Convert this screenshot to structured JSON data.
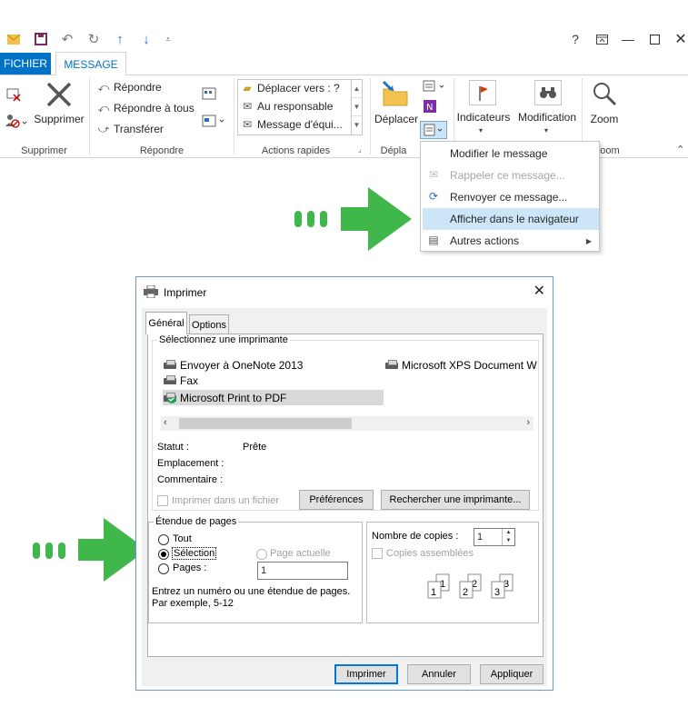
{
  "ribbon": {
    "tabs": {
      "fichier": "FICHIER",
      "message": "MESSAGE"
    },
    "supprimer": {
      "delete": "Supprimer",
      "group": "Supprimer"
    },
    "repondre": {
      "reply": "Répondre",
      "reply_all": "Répondre à tous",
      "forward": "Transférer",
      "group": "Répondre"
    },
    "quick_steps": {
      "items": [
        "Déplacer vers : ?",
        "Au responsable",
        "Message d'équi..."
      ],
      "group": "Actions rapides"
    },
    "deplacer": {
      "move": "Déplacer",
      "group": "Dépla"
    },
    "indicateurs": "Indicateurs",
    "modification": "Modification",
    "zoom": {
      "label": "Zoom",
      "group": "oom"
    },
    "title_buttons": {
      "help": "?"
    }
  },
  "menu": {
    "items": [
      {
        "label": "Modifier le message",
        "disabled": false
      },
      {
        "label": "Rappeler ce message...",
        "disabled": true
      },
      {
        "label": "Renvoyer ce message...",
        "disabled": false
      },
      {
        "label": "Afficher dans le navigateur",
        "disabled": false,
        "highlighted": true
      },
      {
        "label": "Autres actions",
        "disabled": false,
        "submenu": true
      }
    ]
  },
  "dialog": {
    "title": "Imprimer",
    "tabs": {
      "general": "Général",
      "options": "Options"
    },
    "printers_legend": "Sélectionnez une imprimante",
    "printers": {
      "onenote": "Envoyer à OneNote 2013",
      "fax": "Fax",
      "pdf": "Microsoft Print to PDF",
      "xps": "Microsoft XPS Document W"
    },
    "status_label": "Statut :",
    "status_value": "Prête",
    "location_label": "Emplacement :",
    "comment_label": "Commentaire :",
    "print_to_file": "Imprimer dans un fichier",
    "preferences": "Préférences",
    "find_printer": "Rechercher une imprimante...",
    "range_legend": "Étendue de pages",
    "range_all": "Tout",
    "range_selection": "Sélection",
    "range_current": "Page actuelle",
    "range_pages": "Pages :",
    "pages_value": "1",
    "range_hint_1": "Entrez un numéro ou une étendue de pages.",
    "range_hint_2": "Par exemple, 5-12",
    "copies_label": "Nombre de copies :",
    "copies_value": "1",
    "collate": "Copies assemblées",
    "print_btn": "Imprimer",
    "cancel_btn": "Annuler",
    "apply_btn": "Appliquer"
  },
  "colors": {
    "accent": "#0072c6",
    "arrow": "#3fb74a",
    "menu_highlight": "#cde6f7"
  }
}
